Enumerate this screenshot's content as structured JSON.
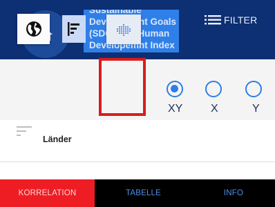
{
  "header": {
    "title": "Sustainable Development Goals (SDG) und Human Developemnt Index (HDI)",
    "filter_label": "FILTER"
  },
  "icons": {
    "home": "home-icon",
    "filter": "filter-list-icon",
    "globe": "globe-icon",
    "bars": "left-aligned-bars-icon",
    "scatter": "dot-grid-icon",
    "sort": "sort-lines-icon"
  },
  "toolbar": {
    "axis_options": [
      {
        "label": "XY",
        "selected": true
      },
      {
        "label": "X",
        "selected": false
      },
      {
        "label": "Y",
        "selected": false
      }
    ]
  },
  "list": {
    "sort_label": "Länder"
  },
  "bottom_nav": {
    "tabs": [
      {
        "label": "KORRELATION",
        "active": true
      },
      {
        "label": "TABELLE",
        "active": false
      },
      {
        "label": "INFO",
        "active": false
      }
    ]
  },
  "colors": {
    "header_bg": "#0d2f73",
    "accent_blue": "#2e7de6",
    "active_tab": "#ee1d24",
    "highlight_frame": "#d81c1c"
  }
}
